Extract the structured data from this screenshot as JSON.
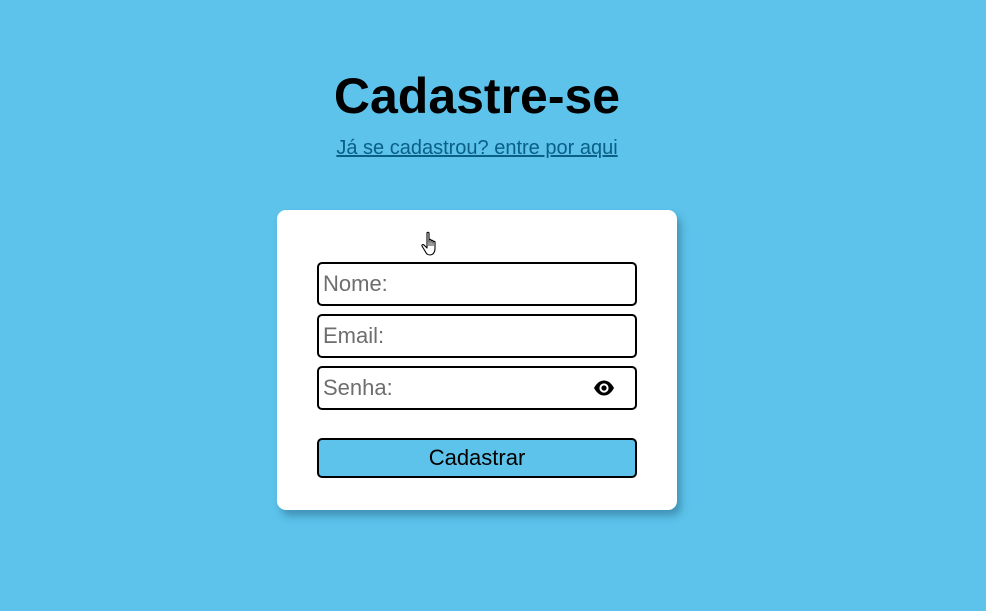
{
  "header": {
    "title": "Cadastre-se",
    "login_link": "Já se cadastrou? entre por aqui"
  },
  "form": {
    "name_placeholder": "Nome:",
    "email_placeholder": "Email:",
    "password_placeholder": "Senha:",
    "password_toggle_icon": "eye-icon",
    "submit_label": "Cadastrar"
  },
  "colors": {
    "background": "#5dc3eb",
    "card": "#ffffff",
    "button": "#5dc3eb",
    "link": "#0a5f86"
  }
}
